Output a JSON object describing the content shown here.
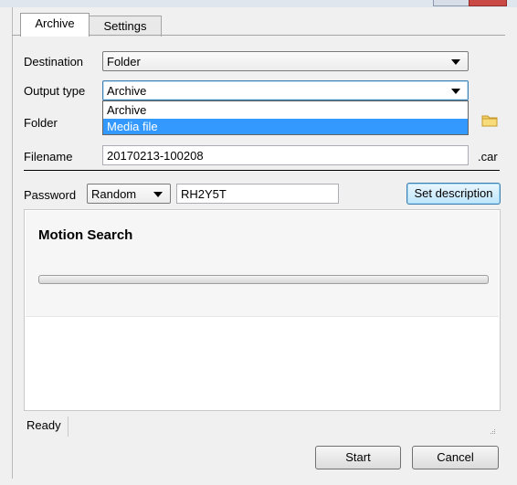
{
  "tabs": [
    {
      "label": "Archive",
      "active": true
    },
    {
      "label": "Settings",
      "active": false
    }
  ],
  "destination": {
    "label": "Destination",
    "value": "Folder"
  },
  "output_type": {
    "label": "Output type",
    "value": "Archive",
    "options": [
      {
        "label": "Archive",
        "highlighted": false
      },
      {
        "label": "Media file",
        "highlighted": true
      }
    ]
  },
  "folder": {
    "label": "Folder",
    "icon": "folder-icon"
  },
  "filename": {
    "label": "Filename",
    "value": "20170213-100208",
    "extension": ".car"
  },
  "password": {
    "label": "Password",
    "mode": "Random",
    "value": "RH2Y5T"
  },
  "set_description_label": "Set description",
  "task_panel": {
    "title": "Motion Search",
    "progress": 0
  },
  "status_text": "Ready",
  "start_label": "Start",
  "cancel_label": "Cancel",
  "colors": {
    "selection": "#3399ff",
    "focus_border": "#3c7fb1"
  }
}
